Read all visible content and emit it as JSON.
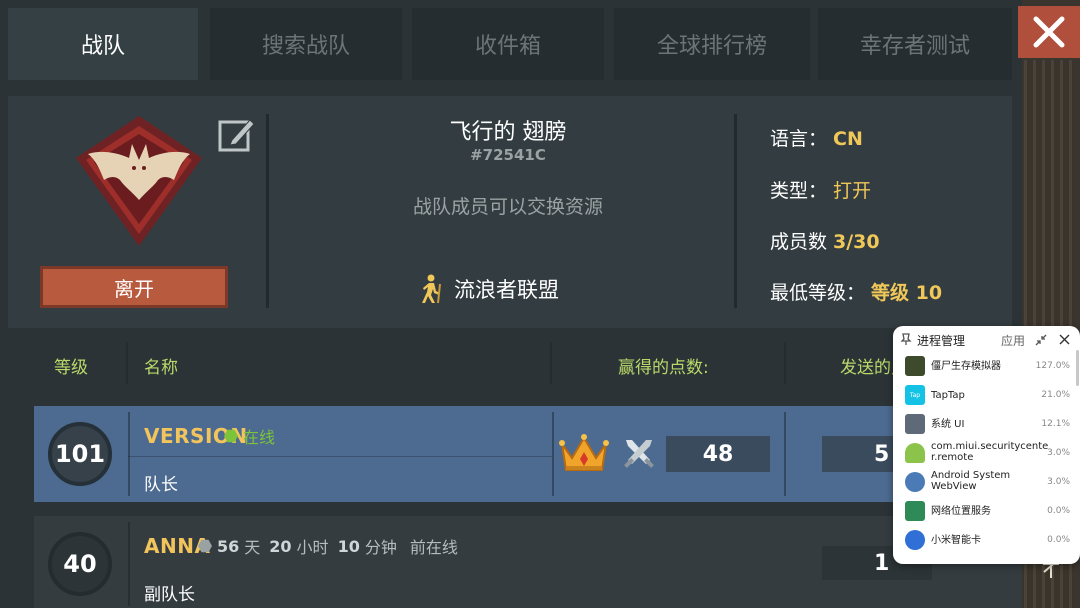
{
  "tabs": [
    {
      "label": "战队",
      "active": true
    },
    {
      "label": "搜索战队",
      "active": false
    },
    {
      "label": "收件箱",
      "active": false
    },
    {
      "label": "全球排行榜",
      "active": false
    },
    {
      "label": "幸存者测试",
      "active": false
    }
  ],
  "team": {
    "name": "飞行的 翅膀",
    "id": "#72541C",
    "description": "战队成员可以交换资源",
    "alliance": "流浪者联盟",
    "leave_label": "离开"
  },
  "info": {
    "language_label": "语言：",
    "language_value": "CN",
    "type_label": "类型：",
    "type_value": "打开",
    "members_label": "成员数",
    "members_value": "3/30",
    "min_level_label": "最低等级：",
    "min_level_value": "等级 10"
  },
  "columns": {
    "level": "等级",
    "name": "名称",
    "earned": "赢得的点数:",
    "sent": "发送的点"
  },
  "members": [
    {
      "level": "101",
      "name": "VERSION",
      "status": "在线",
      "role": "队长",
      "earned": "48",
      "sent": "5"
    },
    {
      "level": "40",
      "name": "ANNA",
      "status_days": "56",
      "status_days_unit": "天",
      "status_hours": "20",
      "status_hours_unit": "小时",
      "status_minutes": "10",
      "status_minutes_unit": "分钟",
      "status_suffix": "前在线",
      "role": "副队长",
      "sent": "1"
    }
  ],
  "process_manager": {
    "title": "进程管理",
    "apply": "应用",
    "items": [
      {
        "name": "僵尸生存模拟器",
        "percent": "127.0%",
        "icon": "game-icon"
      },
      {
        "name": "TapTap",
        "percent": "21.0%",
        "icon": "taptap-icon"
      },
      {
        "name": "系统 UI",
        "percent": "12.1%",
        "icon": "system-ui-icon"
      },
      {
        "name": "com.miui.securitycenter.remote",
        "percent": "3.0%",
        "icon": "android-icon"
      },
      {
        "name": "Android System WebView",
        "percent": "3.0%",
        "icon": "webview-gear-icon"
      },
      {
        "name": "网络位置服务",
        "percent": "0.0%",
        "icon": "android-green-icon"
      },
      {
        "name": "小米智能卡",
        "percent": "0.0%",
        "icon": "nfc-icon"
      }
    ]
  },
  "colors": {
    "accent_gold": "#f2c45c",
    "online_green": "#7cc43a",
    "column_label": "#b9d96a",
    "leave_button": "#b85a3e",
    "close_button": "#b0503c"
  }
}
